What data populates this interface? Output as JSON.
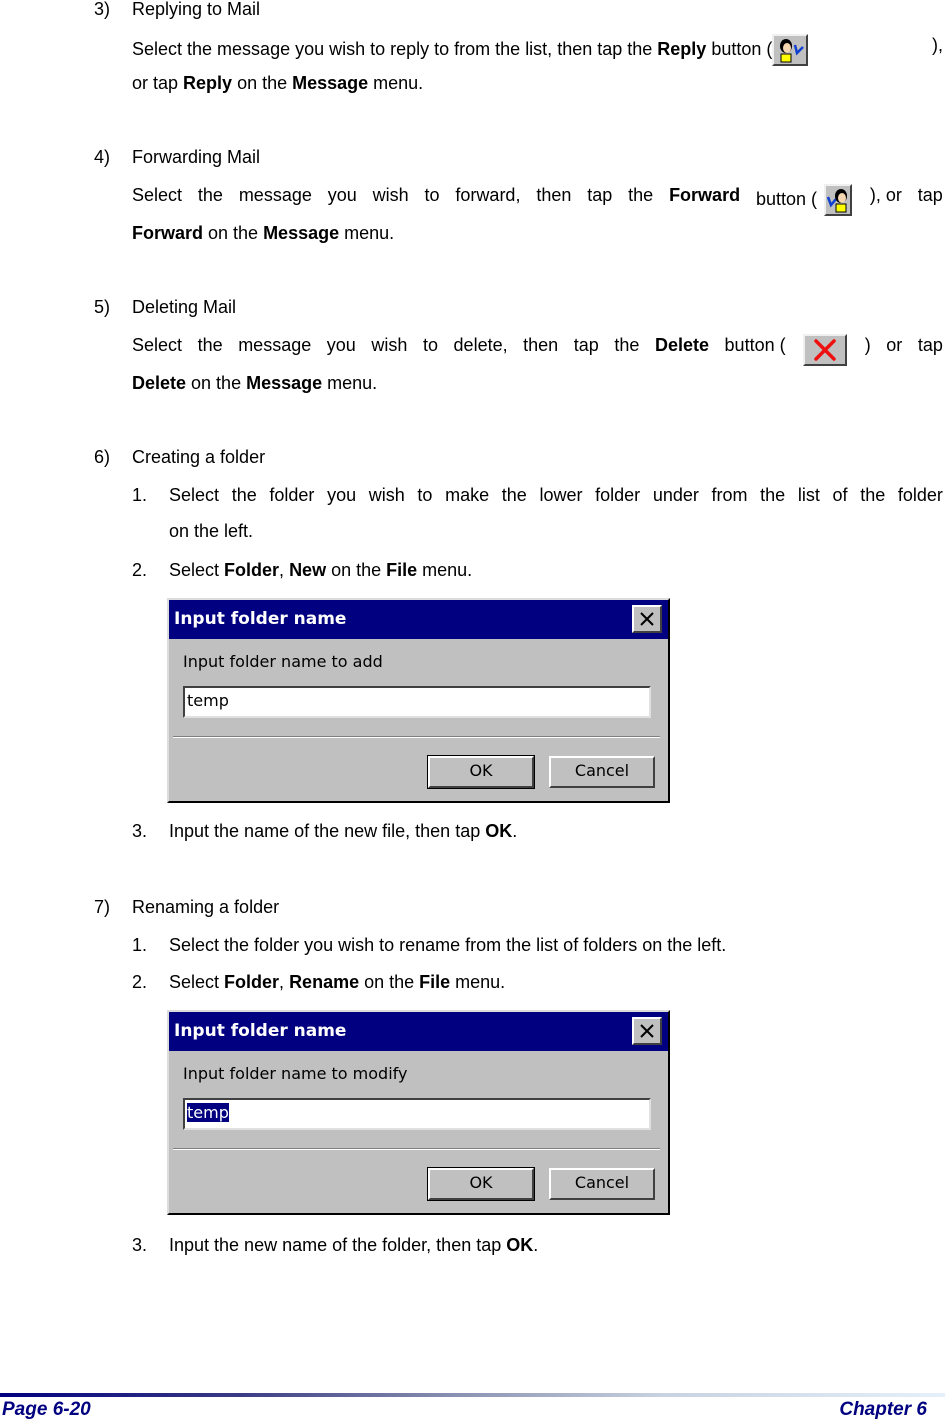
{
  "sections": [
    {
      "number": "3)",
      "title": "Replying to Mail",
      "body": {
        "t1": "Select the message you wish to reply to from the list, then tap the ",
        "b1": "Reply",
        "t2": " button (",
        "icon": "reply-icon",
        "t3": "  ),",
        "line2_t1": "or tap ",
        "line2_b1": "Reply",
        "line2_t2": " on the ",
        "line2_b2": "Message",
        "line2_t3": " menu."
      }
    },
    {
      "number": "4)",
      "title": "Forwarding Mail",
      "body": {
        "words": [
          "Select",
          "the",
          "message",
          "you",
          "wish",
          "to",
          "forward,",
          "then",
          "tap",
          "the"
        ],
        "b1": "Forward",
        "t2": "button (",
        "icon": "forward-icon",
        "t3": "), or",
        "t4": "tap",
        "line2_b1": "Forward",
        "line2_t1": " on the ",
        "line2_b2": "Message",
        "line2_t2": " menu."
      }
    },
    {
      "number": "5)",
      "title": "Deleting Mail",
      "body": {
        "words": [
          "Select",
          "the",
          "message",
          "you",
          "wish",
          "to",
          "delete,",
          "then",
          "tap",
          "the"
        ],
        "b1": "Delete",
        "t2": "button (",
        "icon": "delete-icon",
        "t3": ")",
        "t4": "or",
        "t5": "tap",
        "line2_b1": "Delete",
        "line2_t1": " on the ",
        "line2_b2": "Message",
        "line2_t2": " menu."
      }
    },
    {
      "number": "6)",
      "title": "Creating a folder",
      "steps": [
        {
          "n": "1.",
          "words": [
            "Select",
            "the",
            "folder",
            "you",
            "wish",
            "to",
            "make",
            "the",
            "lower",
            "folder",
            "under",
            "from",
            "the",
            "list",
            "of",
            "the",
            "folder"
          ],
          "line2": "on the left."
        },
        {
          "n": "2.",
          "t1": "Select ",
          "b1": "Folder",
          "t2": ", ",
          "b2": "New",
          "t3": " on the ",
          "b3": "File",
          "t4": " menu."
        },
        {
          "n": "3.",
          "t1": "Input the name of the new file, then tap ",
          "b1": "OK",
          "t2": "."
        }
      ],
      "dialog": {
        "title": "Input folder name",
        "prompt": "Input folder name to add",
        "input_value": "temp",
        "ok_label": "OK",
        "cancel_label": "Cancel"
      }
    },
    {
      "number": "7)",
      "title": "Renaming a folder",
      "steps": [
        {
          "n": "1.",
          "t1": "Select the folder you wish to rename from the list of folders on the left."
        },
        {
          "n": "2.",
          "t1": "Select ",
          "b1": "Folder",
          "t2": ", ",
          "b2": "Rename",
          "t3": " on the ",
          "b3": "File",
          "t4": " menu."
        },
        {
          "n": "3.",
          "t1": "Input the new name of the folder, then tap ",
          "b1": "OK",
          "t2": "."
        }
      ],
      "dialog": {
        "title": "Input folder name",
        "prompt": "Input folder name to modify",
        "input_value": "temp",
        "input_selected": true,
        "ok_label": "OK",
        "cancel_label": "Cancel"
      }
    }
  ],
  "footer": {
    "page": "Page 6-20",
    "chapter": "Chapter 6",
    "bar_color_start": "#000080",
    "bar_color_end": "#e6f0fa",
    "text_color": "#000080"
  }
}
